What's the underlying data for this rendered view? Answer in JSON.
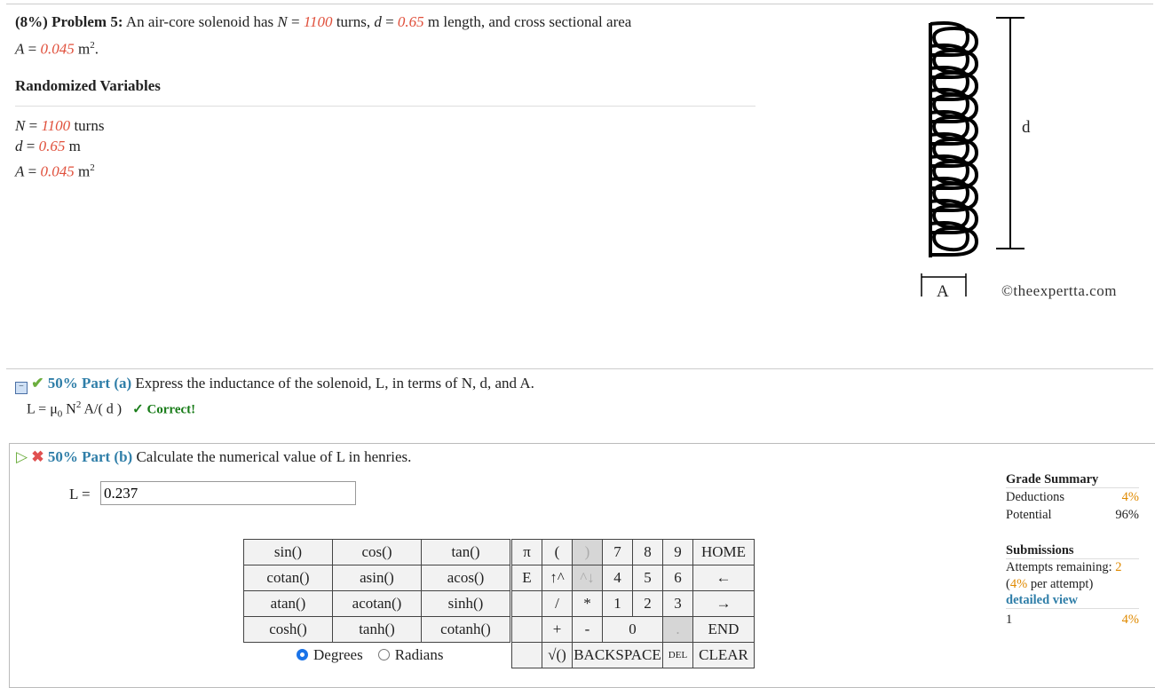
{
  "problem": {
    "header": "(8%) Problem 5:",
    "text_1": "An air-core solenoid has",
    "N_value": "1100",
    "N_unit": "turns,",
    "d_value": "0.65",
    "d_unit": "m length, and cross sectional area",
    "A_value": "0.045",
    "A_unit": "m",
    "A_exp": "2",
    "A_tail": "."
  },
  "randomized": {
    "title": "Randomized Variables",
    "N": {
      "name": "N",
      "value": "1100",
      "unit": "turns"
    },
    "d": {
      "name": "d",
      "value": "0.65",
      "unit": "m"
    },
    "A": {
      "name": "A",
      "value": "0.045",
      "unit": "m",
      "exp": "2"
    }
  },
  "figure": {
    "d_label": "d",
    "A_label": "A",
    "watermark": "©theexpertta.com"
  },
  "part_a": {
    "weight": "50%",
    "title": "Part (a)",
    "prompt": "Express the inductance of the solenoid, L, in terms of N, d, and A.",
    "answer_prefix": "L = μ",
    "answer_sub": "0",
    "answer_mid": " N",
    "answer_exp": "2",
    "answer_tail": " A/( d )",
    "status": "✓ Correct!"
  },
  "part_b": {
    "weight": "50%",
    "title": "Part (b)",
    "prompt": "Calculate the numerical value of L in henries.",
    "input_label": "L =",
    "input_value": "0.237"
  },
  "keypad": {
    "functions": [
      [
        "sin()",
        "cos()",
        "tan()"
      ],
      [
        "cotan()",
        "asin()",
        "acos()"
      ],
      [
        "atan()",
        "acotan()",
        "sinh()"
      ],
      [
        "cosh()",
        "tanh()",
        "cotanh()"
      ]
    ],
    "degrees": "Degrees",
    "radians": "Radians",
    "row1": [
      "π",
      "(",
      ")",
      "7",
      "8",
      "9",
      "HOME"
    ],
    "row2": [
      "E",
      "↑^",
      "^↓",
      "4",
      "5",
      "6",
      "←"
    ],
    "row3": [
      "/",
      "*",
      "1",
      "2",
      "3",
      "→"
    ],
    "row4": [
      "+",
      "-",
      "0",
      ".",
      "END"
    ],
    "row5": [
      "√()",
      "BACKSPACE",
      "DEL",
      "CLEAR"
    ]
  },
  "grade": {
    "title": "Grade Summary",
    "deductions_label": "Deductions",
    "deductions_value": "4%",
    "potential_label": "Potential",
    "potential_value": "96%",
    "submissions_title": "Submissions",
    "attempts_label": "Attempts remaining:",
    "attempts_value": "2",
    "per_attempt_value": "4%",
    "per_attempt_label": "per attempt)",
    "detailed": "detailed view",
    "sub_index": "1",
    "sub_value": "4%"
  }
}
